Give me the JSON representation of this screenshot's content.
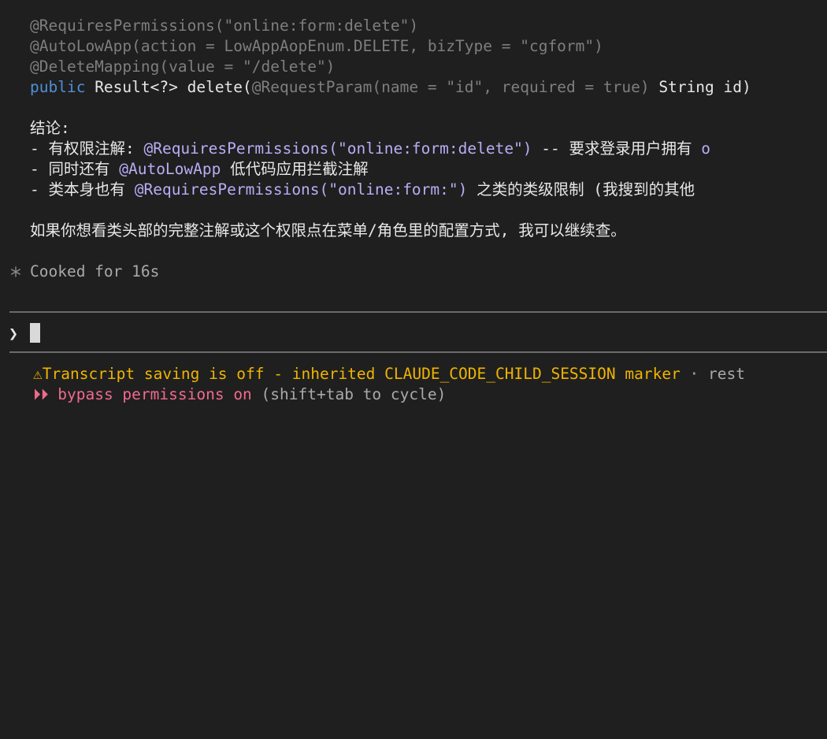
{
  "code": {
    "line1": "@RequiresPermissions(\"online:form:delete\")",
    "line2": "@AutoLowApp(action = LowAppAopEnum.DELETE, bizType = \"cgform\")",
    "line3": "@DeleteMapping(value = \"/delete\")",
    "line4_kw": "public",
    "line4_text": " Result<?> delete(",
    "line4_dim": "@RequestParam(name = \"id\", required = true)",
    "line4_tail": " String id)"
  },
  "conclusion": {
    "heading": "结论:",
    "b1_prefix": "- 有权限注解: ",
    "b1_anno": "@RequiresPermissions(\"online:form:delete\")",
    "b1_suffix": " -- 要求登录用户拥有 ",
    "b1_tail": "o",
    "b2_prefix": "- 同时还有 ",
    "b2_anno": "@AutoLowApp",
    "b2_suffix": " 低代码应用拦截注解",
    "b3_prefix": "- 类本身也有 ",
    "b3_anno": "@RequiresPermissions(\"online:form:\")",
    "b3_suffix": " 之类的类级限制 (我搜到的其他"
  },
  "followup": "如果你想看类头部的完整注解或这个权限点在菜单/角色里的配置方式, 我可以继续查。",
  "status": {
    "spinner_icon": "asterisk-icon",
    "text": "Cooked for 16s"
  },
  "prompt": {
    "arrow": "❯",
    "value": ""
  },
  "footer": {
    "warning_icon": "⚠",
    "warning_text": "Transcript saving is off - inherited CLAUDE_CODE_CHILD_SESSION marker",
    "warning_sep": " · ",
    "warning_tail": "rest",
    "mode_icon": "⏵⏵",
    "mode_text": " bypass permissions on",
    "mode_hint": " (shift+tab to cycle)"
  },
  "colors": {
    "background": "#1f1f1f",
    "keyword": "#4f8fd6",
    "annotation": "#b7aef5",
    "warning": "#f0b400",
    "mode": "#f06a8e"
  }
}
